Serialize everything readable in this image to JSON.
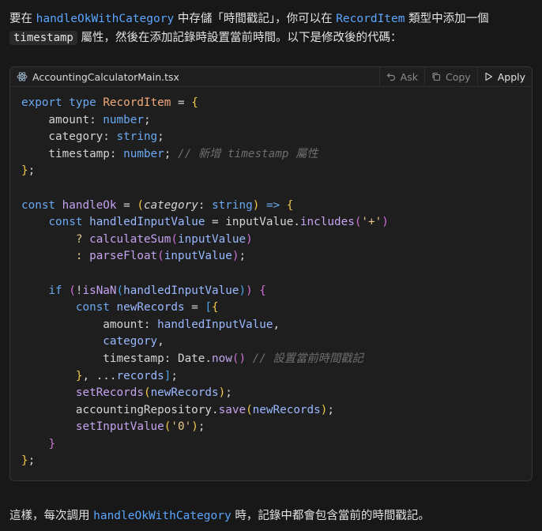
{
  "intro": {
    "t1": "要在 ",
    "id1": "handleOkWithCategory",
    "t2": " 中存儲「時間戳記」，你可以在 ",
    "id2": "RecordItem",
    "t3": " 類型中添加一個 ",
    "code1": "timestamp",
    "t4": " 屬性，然後在添加記錄時設置當前時間。以下是修改後的代碼："
  },
  "code_block": {
    "file_icon": "react-atom-icon",
    "filename": "AccountingCalculatorMain.tsx",
    "actions": [
      {
        "label": "Ask",
        "icon": "undo-arrow-icon"
      },
      {
        "label": "Copy",
        "icon": "copy-icon"
      },
      {
        "label": "Apply",
        "icon": "play-icon"
      }
    ],
    "lines": [
      "export type RecordItem = {",
      "    amount: number;",
      "    category: string;",
      "    timestamp: number; // 新增 timestamp 屬性",
      "};",
      "",
      "const handleOk = (category: string) => {",
      "    const handledInputValue = inputValue.includes('+')",
      "        ? calculateSum(inputValue)",
      "        : parseFloat(inputValue);",
      "",
      "    if (!isNaN(handledInputValue)) {",
      "        const newRecords = [{",
      "            amount: handledInputValue,",
      "            category,",
      "            timestamp: Date.now() // 設置當前時間戳記",
      "        }, ...records];",
      "        setRecords(newRecords);",
      "        accountingRepository.save(newRecords);",
      "        setInputValue('0');",
      "    }",
      "};"
    ]
  },
  "outro": {
    "t1": "這樣，每次調用 ",
    "id1": "handleOkWithCategory",
    "t2": " 時，記錄中都會包含當前的時間戳記。"
  }
}
